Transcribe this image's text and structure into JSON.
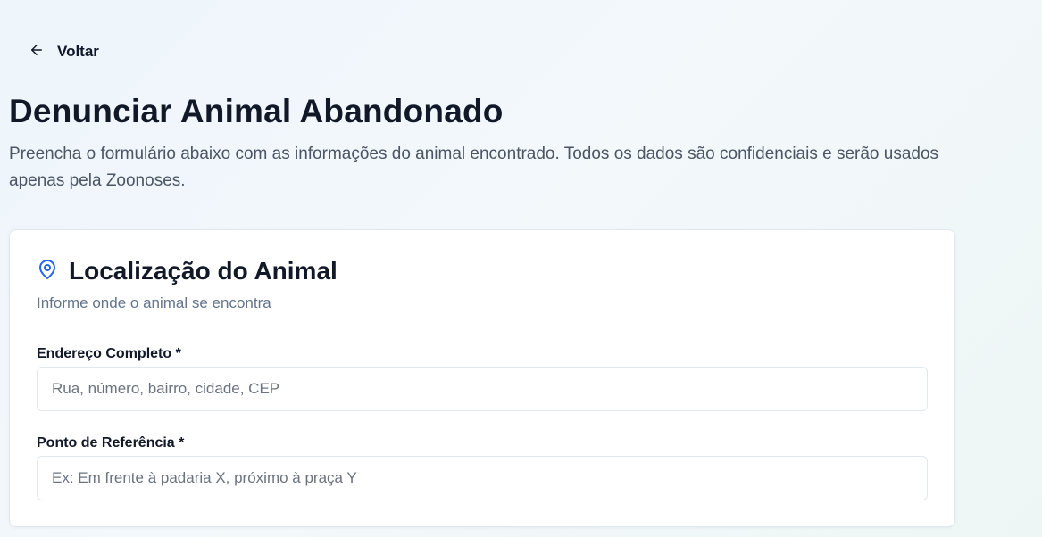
{
  "nav": {
    "back_label": "Voltar"
  },
  "header": {
    "title": "Denunciar Animal Abandonado",
    "subtitle": "Preencha o formulário abaixo com as informações do animal encontrado. Todos os dados são confidenciais e serão usados apenas pela Zoonoses."
  },
  "location_card": {
    "icon": "map-pin-icon",
    "title": "Localização do Animal",
    "description": "Informe onde o animal se encontra",
    "fields": [
      {
        "label": "Endereço Completo *",
        "value": "",
        "placeholder": "Rua, número, bairro, cidade, CEP"
      },
      {
        "label": "Ponto de Referência *",
        "value": "",
        "placeholder": "Ex: Em frente à padaria X, próximo à praça Y"
      }
    ]
  },
  "colors": {
    "accent": "#2563eb",
    "text": "#111827",
    "muted": "#64748b"
  }
}
